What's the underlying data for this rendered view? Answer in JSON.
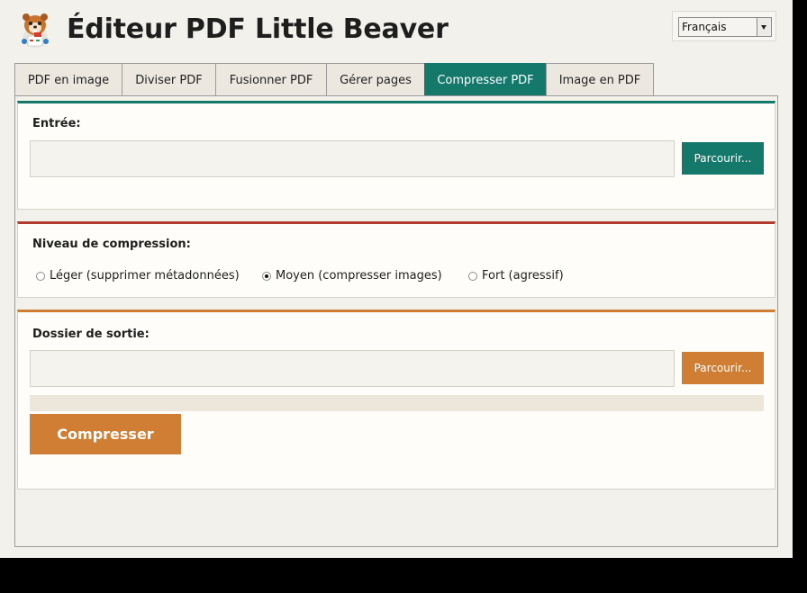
{
  "app": {
    "title": "Éditeur PDF Little Beaver",
    "language": "Français"
  },
  "tabs": [
    {
      "label": "PDF en image",
      "active": false
    },
    {
      "label": "Diviser PDF",
      "active": false
    },
    {
      "label": "Fusionner PDF",
      "active": false
    },
    {
      "label": "Gérer pages",
      "active": false
    },
    {
      "label": "Compresser PDF",
      "active": true
    },
    {
      "label": "Image en PDF",
      "active": false
    }
  ],
  "input_section": {
    "label": "Entrée:",
    "value": "",
    "browse_label": "Parcourir..."
  },
  "level_section": {
    "label": "Niveau de compression:",
    "options": [
      {
        "label": "Léger (supprimer métadonnées)",
        "selected": false
      },
      {
        "label": "Moyen (compresser images)",
        "selected": true
      },
      {
        "label": "Fort (agressif)",
        "selected": false
      }
    ]
  },
  "output_section": {
    "label": "Dossier de sortie:",
    "value": "",
    "browse_label": "Parcourir...",
    "progress": 0,
    "compress_label": "Compresser"
  },
  "colors": {
    "accent_teal": "#14796b",
    "accent_red": "#b13b2c",
    "accent_orange": "#cf7e34"
  }
}
